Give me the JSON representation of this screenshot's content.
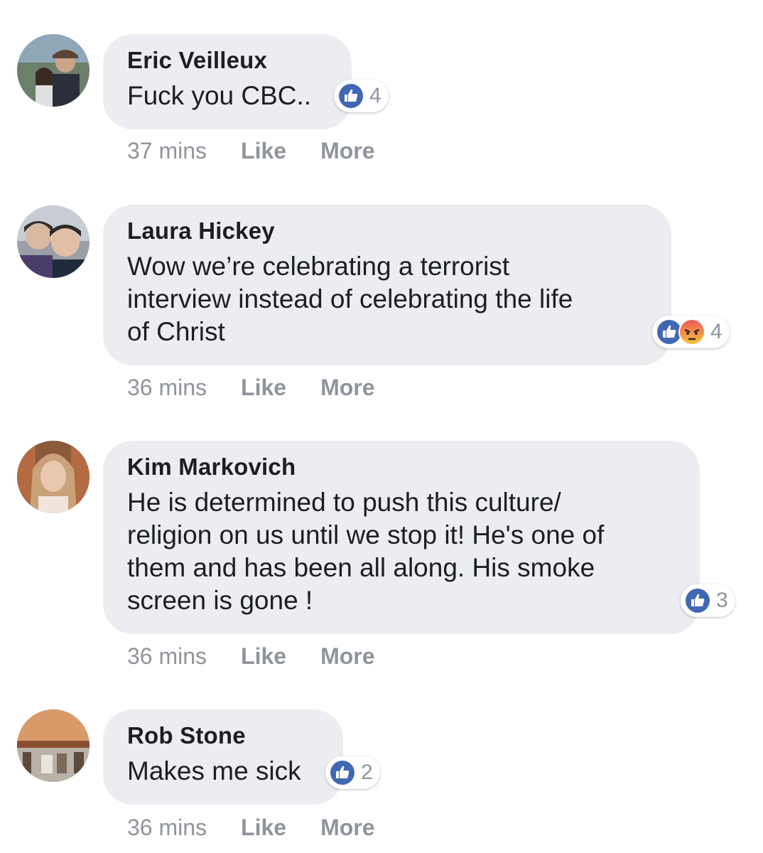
{
  "comments": [
    {
      "author": "Eric Veilleux",
      "text": "Fuck you CBC..",
      "reaction_count": "4",
      "reactions": [
        "like"
      ],
      "time": "37 mins",
      "like_label": "Like",
      "more_label": "More"
    },
    {
      "author": "Laura Hickey",
      "text": "Wow we’re celebrating a terrorist\ninterview instead of celebrating the life\nof Christ",
      "reaction_count": "4",
      "reactions": [
        "like",
        "angry"
      ],
      "time": "36 mins",
      "like_label": "Like",
      "more_label": "More"
    },
    {
      "author": "Kim Markovich",
      "text": "He is determined to push this culture/\nreligion on us until we stop it! He's one of\nthem and has been all along. His smoke\nscreen is gone !",
      "reaction_count": "3",
      "reactions": [
        "like"
      ],
      "time": "36 mins",
      "like_label": "Like",
      "more_label": "More"
    },
    {
      "author": "Rob Stone",
      "text": "Makes me sick",
      "reaction_count": "2",
      "reactions": [
        "like"
      ],
      "time": "36 mins",
      "like_label": "Like",
      "more_label": "More"
    }
  ],
  "colors": {
    "bubble": "#ebedf0",
    "like_blue": "#4267b2",
    "angry_top": "#f0595a",
    "angry_bottom": "#f5c33b",
    "meta_text": "#90949c"
  }
}
